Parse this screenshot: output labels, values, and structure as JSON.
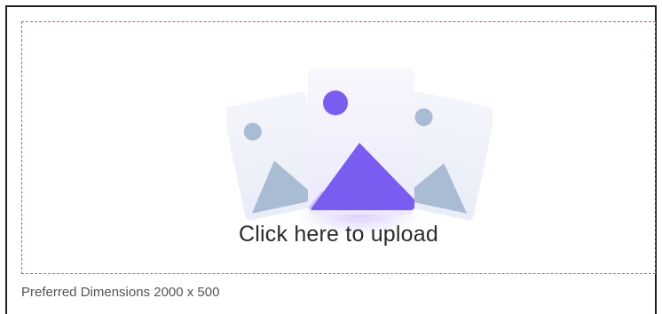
{
  "upload": {
    "label": "Click here to upload",
    "hint": "Preferred Dimensions 2000 x 500",
    "icon": "image-gallery-icon"
  },
  "colors": {
    "dashed_border": "#e8485f",
    "accent": "#7b5cf0",
    "muted_card": "#a9bcd3"
  }
}
